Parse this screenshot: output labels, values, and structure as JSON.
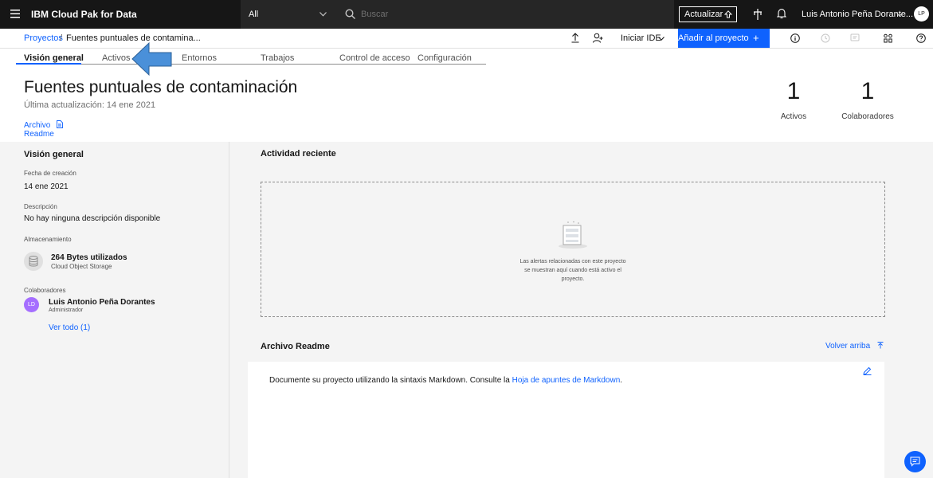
{
  "colors": {
    "brand_blue": "#0f62fe",
    "topbar_bg": "#161616",
    "panel_bg": "#f4f4f4",
    "avatar_purple": "#a56eff"
  },
  "topbar": {
    "product": "IBM Cloud Pak for Data",
    "scope": "All",
    "search_placeholder": "Buscar",
    "upgrade_label": "Actualizar",
    "user_name": "Luis Antonio Peña Dorante...",
    "user_initials": "LP"
  },
  "breadcrumb": {
    "parent": "Proyectos",
    "sep": "/",
    "current": "Fuentes puntuales de contamina..."
  },
  "actions": {
    "ide_label": "Iniciar IDE",
    "add_label": "Añadir al proyecto",
    "add_symbol": "+"
  },
  "tabs": [
    "Visión general",
    "Activos",
    "Entornos",
    "Trabajos",
    "Control de acceso",
    "Configuración"
  ],
  "project": {
    "title": "Fuentes puntuales de contaminación",
    "updated": "Última actualización: 14 ene 2021",
    "archivo_label": "Archivo",
    "readme_label": "Readme"
  },
  "stats": [
    {
      "value": "1",
      "label": "Activos"
    },
    {
      "value": "1",
      "label": "Colaboradores"
    }
  ],
  "overview": {
    "heading": "Visión general",
    "created_label": "Fecha de creación",
    "created_value": "14 ene 2021",
    "description_label": "Descripción",
    "description_value": "No hay ninguna descripción disponible",
    "storage_label": "Almacenamiento",
    "storage_used": "264 Bytes utilizados",
    "storage_type": "Cloud Object Storage",
    "collab_label": "Colaboradores",
    "collab_name": "Luis Antonio Peña Dorantes",
    "collab_role": "Administrador",
    "collab_initials": "LD",
    "view_all": "Ver todo (1)"
  },
  "activity": {
    "heading": "Actividad reciente",
    "empty_line1": "Las alertas relacionadas con este proyecto",
    "empty_line2": "se muestran aquí cuando está activo el",
    "empty_line3": "proyecto."
  },
  "readme": {
    "heading": "Archivo Readme",
    "back_to_top": "Volver arriba",
    "text": "Documente su proyecto utilizando la sintaxis Markdown. Consulte la",
    "link": "Hoja de apuntes de Markdown",
    "period": "."
  }
}
